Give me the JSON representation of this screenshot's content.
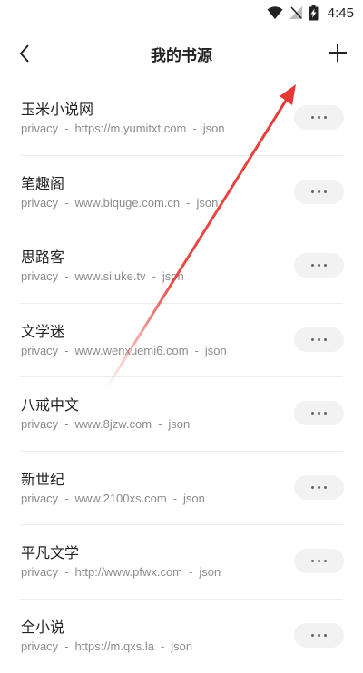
{
  "status": {
    "time": "4:45"
  },
  "header": {
    "title": "我的书源"
  },
  "sources": [
    {
      "name": "玉米小说网",
      "type": "privacy",
      "url": "https://m.yumitxt.com",
      "format": "json"
    },
    {
      "name": "笔趣阁",
      "type": "privacy",
      "url": "www.biquge.com.cn",
      "format": "json"
    },
    {
      "name": "思路客",
      "type": "privacy",
      "url": "www.siluke.tv",
      "format": "json"
    },
    {
      "name": "文学迷",
      "type": "privacy",
      "url": "www.wenxuemi6.com",
      "format": "json"
    },
    {
      "name": "八戒中文",
      "type": "privacy",
      "url": "www.8jzw.com",
      "format": "json"
    },
    {
      "name": "新世纪",
      "type": "privacy",
      "url": "www.2100xs.com",
      "format": "json"
    },
    {
      "name": "平凡文学",
      "type": "privacy",
      "url": "http://www.pfwx.com",
      "format": "json"
    },
    {
      "name": "全小说",
      "type": "privacy",
      "url": "https://m.qxs.la",
      "format": "json"
    }
  ],
  "colors": {
    "annotation_arrow": "#e53935"
  }
}
